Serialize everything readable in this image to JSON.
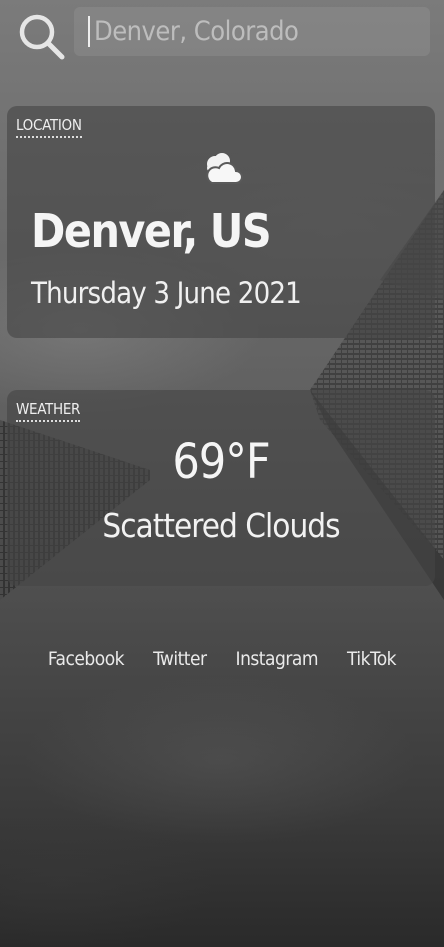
{
  "search": {
    "placeholder": "Denver, Colorado",
    "value": "",
    "icon": "search-icon"
  },
  "location": {
    "label": "LOCATION",
    "icon": "partly-cloudy-icon",
    "city": "Denver, US",
    "date": "Thursday 3 June 2021"
  },
  "weather": {
    "label": "WEATHER",
    "temperature": "69°F",
    "condition": "Scattered Clouds"
  },
  "social": {
    "links": [
      "Facebook",
      "Twitter",
      "Instagram",
      "TikTok"
    ]
  }
}
